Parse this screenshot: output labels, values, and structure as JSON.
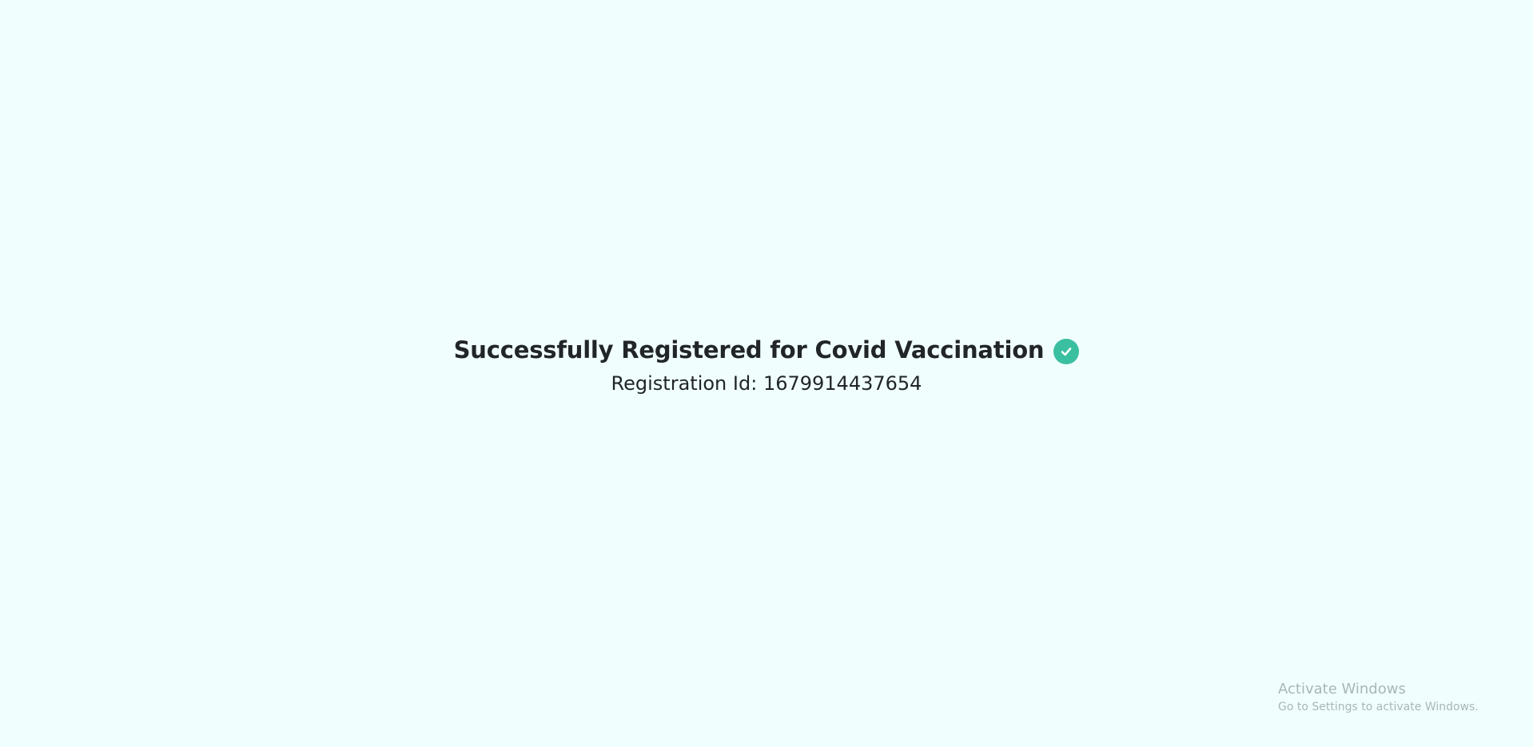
{
  "confirmation": {
    "title": "Successfully Registered for Covid Vaccination",
    "status_icon": "check-circle-icon",
    "registration_label": "Registration Id:",
    "registration_id": "1679914437654"
  },
  "watermark": {
    "title": "Activate Windows",
    "subtitle": "Go to Settings to activate Windows."
  },
  "colors": {
    "background": "#f0fffe",
    "text": "#212529",
    "success": "#3abfa0",
    "watermark": "#a9b6b6"
  }
}
